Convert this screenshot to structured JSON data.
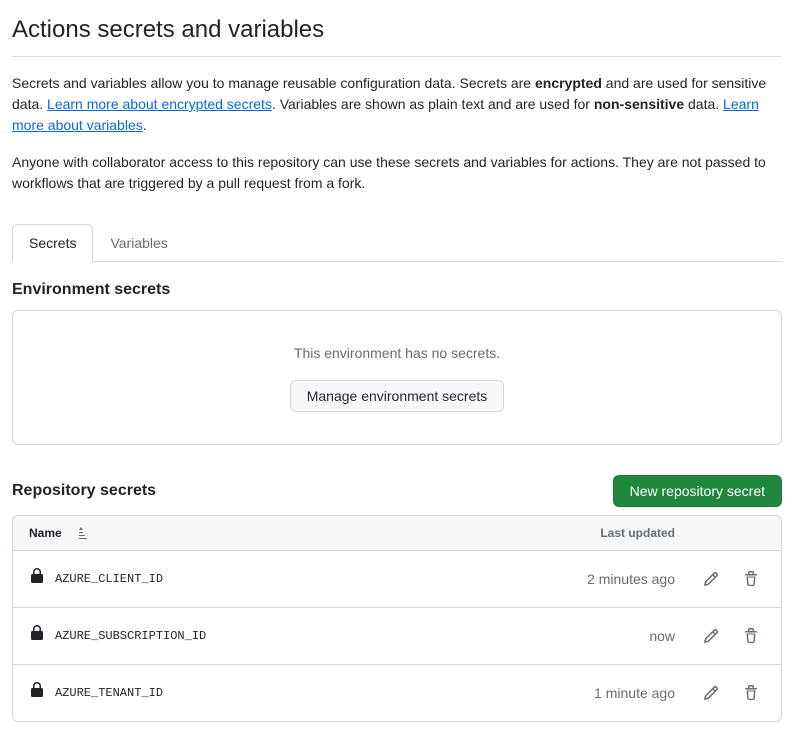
{
  "page": {
    "title": "Actions secrets and variables",
    "intro1_pre": "Secrets and variables allow you to manage reusable configuration data. Secrets are ",
    "intro1_bold1": "encrypted",
    "intro1_mid": " and are used for sensitive data. ",
    "intro1_link1": "Learn more about encrypted secrets",
    "intro1_mid2": ". Variables are shown as plain text and are used for ",
    "intro1_bold2": "non-sensitive",
    "intro1_mid3": " data. ",
    "intro1_link2": "Learn more about variables",
    "intro1_end": ".",
    "intro2": "Anyone with collaborator access to this repository can use these secrets and variables for actions. They are not passed to workflows that are triggered by a pull request from a fork."
  },
  "tabs": {
    "secrets": "Secrets",
    "variables": "Variables"
  },
  "env_secrets": {
    "title": "Environment secrets",
    "empty_msg": "This environment has no secrets.",
    "manage_btn": "Manage environment secrets"
  },
  "repo_secrets": {
    "title": "Repository secrets",
    "new_btn": "New repository secret",
    "col_name": "Name",
    "col_updated": "Last updated",
    "rows": [
      {
        "name": "AZURE_CLIENT_ID",
        "updated": "2 minutes ago"
      },
      {
        "name": "AZURE_SUBSCRIPTION_ID",
        "updated": "now"
      },
      {
        "name": "AZURE_TENANT_ID",
        "updated": "1 minute ago"
      }
    ]
  }
}
